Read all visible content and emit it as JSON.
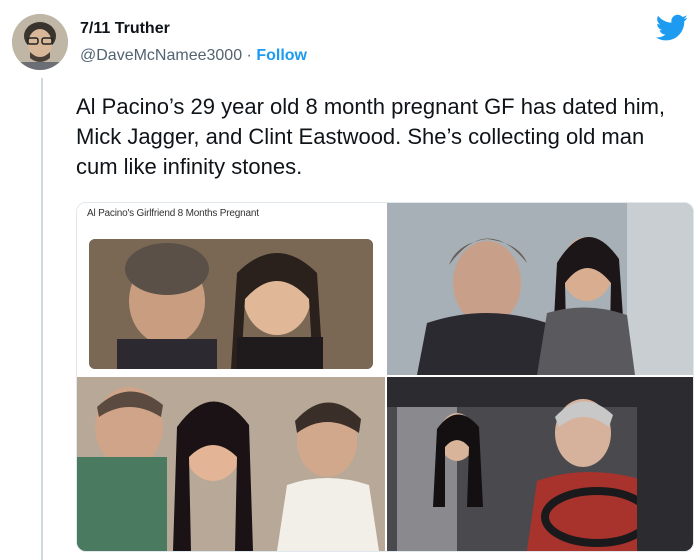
{
  "author": {
    "display_name": "7/11 Truther",
    "handle": "@DaveMcNamee3000",
    "separator": "·",
    "follow_label": "Follow"
  },
  "tweet": {
    "text": "Al Pacino’s 29 year old 8 month pregnant GF has dated him, Mick Jagger, and Clint Eastwood. She’s collecting old man cum like infinity stones."
  },
  "media": {
    "caption": "Al Pacino's Girlfriend 8 Months Pregnant"
  },
  "colors": {
    "accent": "#1d9bf0",
    "text": "#0f1419",
    "secondary": "#536471"
  },
  "icons": {
    "logo": "twitter-bird-icon"
  }
}
